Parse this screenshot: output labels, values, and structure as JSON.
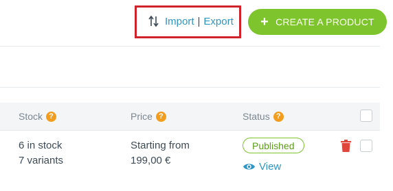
{
  "toolbar": {
    "import_label": "Import",
    "separator": "|",
    "export_label": "Export",
    "create_button_label": "CREATE A PRODUCT",
    "create_button_icon": "plus-icon",
    "import_export_icon": "sort-arrows-icon"
  },
  "colors": {
    "accent_green": "#7ec42d",
    "link_blue": "#2f95c4",
    "help_orange": "#f29d1e",
    "delete_red": "#e0463b",
    "highlight_red": "#d0222a"
  },
  "table": {
    "columns": [
      {
        "label": "Stock",
        "help": "?"
      },
      {
        "label": "Price",
        "help": "?"
      },
      {
        "label": "Status",
        "help": "?"
      }
    ],
    "rows": [
      {
        "stock_line1": "6 in stock",
        "stock_line2": "7 variants",
        "price_line1": "Starting from",
        "price_line2": "199,00 €",
        "status": "Published",
        "view_label": "View"
      }
    ]
  }
}
